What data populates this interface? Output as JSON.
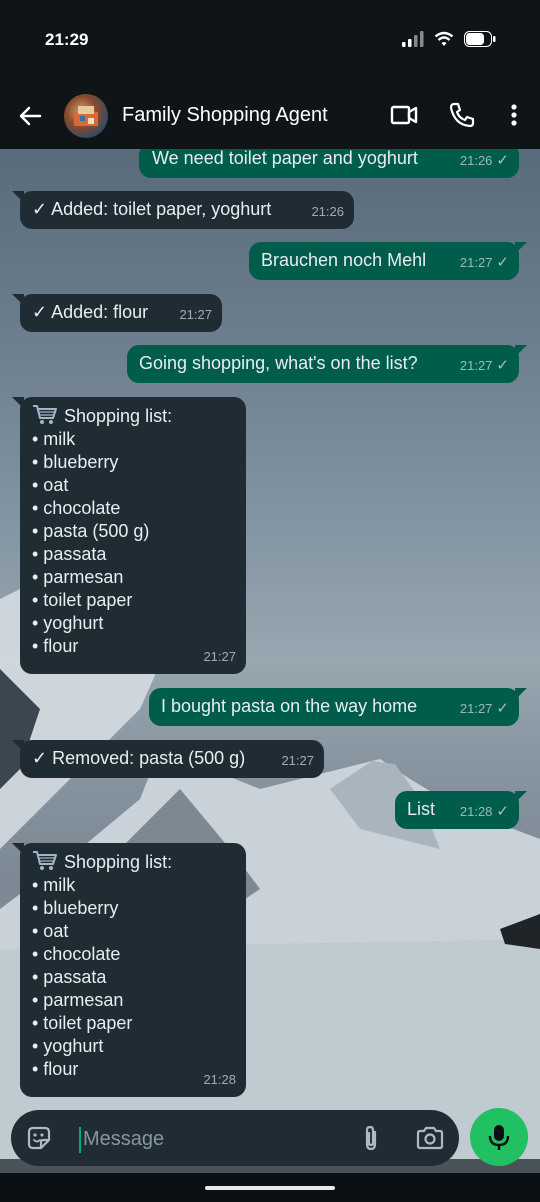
{
  "status": {
    "time": "21:29"
  },
  "header": {
    "title": "Family Shopping Agent"
  },
  "messages": [
    {
      "text": "We need toilet paper and yoghurt",
      "time": "21:26"
    },
    {
      "text": "✓ Added: toilet paper, yoghurt",
      "time": "21:26"
    },
    {
      "text": "Brauchen noch Mehl",
      "time": "21:27"
    },
    {
      "text": "✓ Added: flour",
      "time": "21:27"
    },
    {
      "text": "Going shopping, what's on the list?",
      "time": "21:27"
    },
    {
      "title": "Shopping list:",
      "items": [
        "• milk",
        "• blueberry",
        "• oat",
        "• chocolate",
        "• pasta (500 g)",
        "• passata",
        "• parmesan",
        "• toilet paper",
        "• yoghurt",
        "• flour"
      ],
      "time": "21:27"
    },
    {
      "text": "I bought pasta on the way home",
      "time": "21:27"
    },
    {
      "text": "✓ Removed: pasta (500 g)",
      "time": "21:27"
    },
    {
      "text": "List",
      "time": "21:28"
    },
    {
      "title": "Shopping list:",
      "items": [
        "• milk",
        "• blueberry",
        "• oat",
        "• chocolate",
        "• passata",
        "• parmesan",
        "• toilet paper",
        "• yoghurt",
        "• flour"
      ],
      "time": "21:28"
    }
  ],
  "composer": {
    "placeholder": "Message"
  },
  "colors": {
    "incoming": "#1f2c34",
    "outgoing": "#005c4b",
    "mic": "#21c063",
    "accent": "#00a884"
  },
  "icons": [
    "back-arrow-icon",
    "video-call-icon",
    "phone-icon",
    "more-vert-icon",
    "sticker-icon",
    "attach-icon",
    "camera-icon",
    "mic-icon",
    "cart-icon",
    "read-check-icon"
  ]
}
